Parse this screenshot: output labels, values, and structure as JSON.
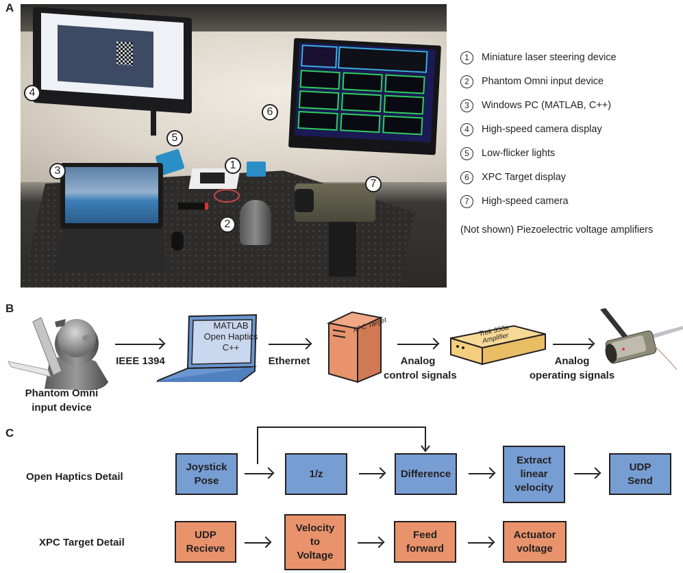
{
  "figure": {
    "panel_labels": {
      "a": "A",
      "b": "B",
      "c": "C"
    }
  },
  "panel_a": {
    "photo_description": "Photograph of laboratory setup on optical table",
    "callouts": [
      "1",
      "2",
      "3",
      "4",
      "5",
      "6",
      "7"
    ],
    "legend": [
      {
        "num": "1",
        "label": "Miniature laser steering device"
      },
      {
        "num": "2",
        "label": "Phantom Omni input device"
      },
      {
        "num": "3",
        "label": "Windows PC (MATLAB, C++)"
      },
      {
        "num": "4",
        "label": "High-speed camera display"
      },
      {
        "num": "5",
        "label": "Low-flicker lights"
      },
      {
        "num": "6",
        "label": "XPC Target display"
      },
      {
        "num": "7",
        "label": "High-speed camera"
      }
    ],
    "not_shown": "(Not shown) Piezoelectric voltage amplifiers"
  },
  "panel_b": {
    "device_label_line1": "Phantom Omni",
    "device_label_line2": "input device",
    "link1": "IEEE 1394",
    "laptop_screen": [
      "MATLAB",
      "Open Haptics",
      "C++"
    ],
    "link2": "Ethernet",
    "tower_label": "XPC Target",
    "link3_line1": "Analog",
    "link3_line2": "control signals",
    "amplifier_line1": "Trek 350a",
    "amplifier_line2": "Amplifier",
    "link4_line1": "Analog",
    "link4_line2": "operating signals"
  },
  "panel_c": {
    "row1_label": "Open Haptics Detail",
    "row1_blocks": [
      {
        "lines": [
          "Joystick",
          "Pose"
        ]
      },
      {
        "lines": [
          "1/z"
        ]
      },
      {
        "lines": [
          "Difference"
        ]
      },
      {
        "lines": [
          "Extract",
          "linear",
          "velocity"
        ]
      },
      {
        "lines": [
          "UDP",
          "Send"
        ]
      }
    ],
    "row2_label": "XPC Target Detail",
    "row2_blocks": [
      {
        "lines": [
          "UDP",
          "Recieve"
        ]
      },
      {
        "lines": [
          "Velocity",
          "to",
          "Voltage"
        ]
      },
      {
        "lines": [
          "Feed",
          "forward"
        ]
      },
      {
        "lines": [
          "Actuator",
          "voltage"
        ]
      }
    ]
  },
  "colors": {
    "block_blue": "#779ed3",
    "block_orange": "#e8936c",
    "amplifier_yellow": "#f3ce7e",
    "laptop_blue": "#6b96d0",
    "laptop_screen": "#c9d7ef",
    "ink": "#231f20"
  }
}
